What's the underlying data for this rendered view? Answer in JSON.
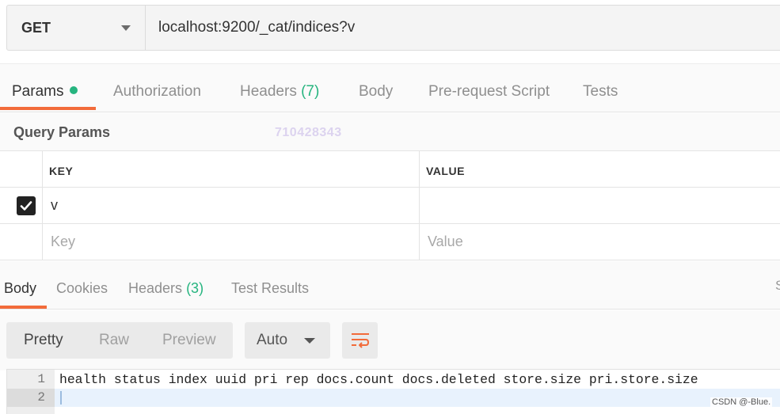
{
  "request": {
    "method": "GET",
    "url": "localhost:9200/_cat/indices?v"
  },
  "request_tabs": [
    {
      "label": "Params",
      "active": true,
      "has_dot": true
    },
    {
      "label": "Authorization"
    },
    {
      "label": "Headers",
      "count": "(7)"
    },
    {
      "label": "Body"
    },
    {
      "label": "Pre-request Script"
    },
    {
      "label": "Tests"
    }
  ],
  "query_params": {
    "title": "Query Params",
    "watermark": "710428343",
    "columns": {
      "key": "KEY",
      "value": "VALUE"
    },
    "rows": [
      {
        "checked": true,
        "key": "v",
        "value": ""
      }
    ],
    "new_row": {
      "key_placeholder": "Key",
      "value_placeholder": "Value"
    }
  },
  "response_tabs": [
    {
      "label": "Body",
      "active": true
    },
    {
      "label": "Cookies"
    },
    {
      "label": "Headers",
      "count": "(3)"
    },
    {
      "label": "Test Results"
    }
  ],
  "edge_text": "S",
  "viewer": {
    "modes": [
      "Pretty",
      "Raw",
      "Preview"
    ],
    "active_mode": "Pretty",
    "format": "Auto"
  },
  "response_lines": [
    {
      "number": "1",
      "text": "health status index uuid pri rep docs.count docs.deleted store.size pri.store.size"
    },
    {
      "number": "2",
      "text": ""
    }
  ],
  "credit": "CSDN @-Blue.",
  "colors": {
    "accent": "#f26b3a",
    "dot": "#26b47f"
  }
}
